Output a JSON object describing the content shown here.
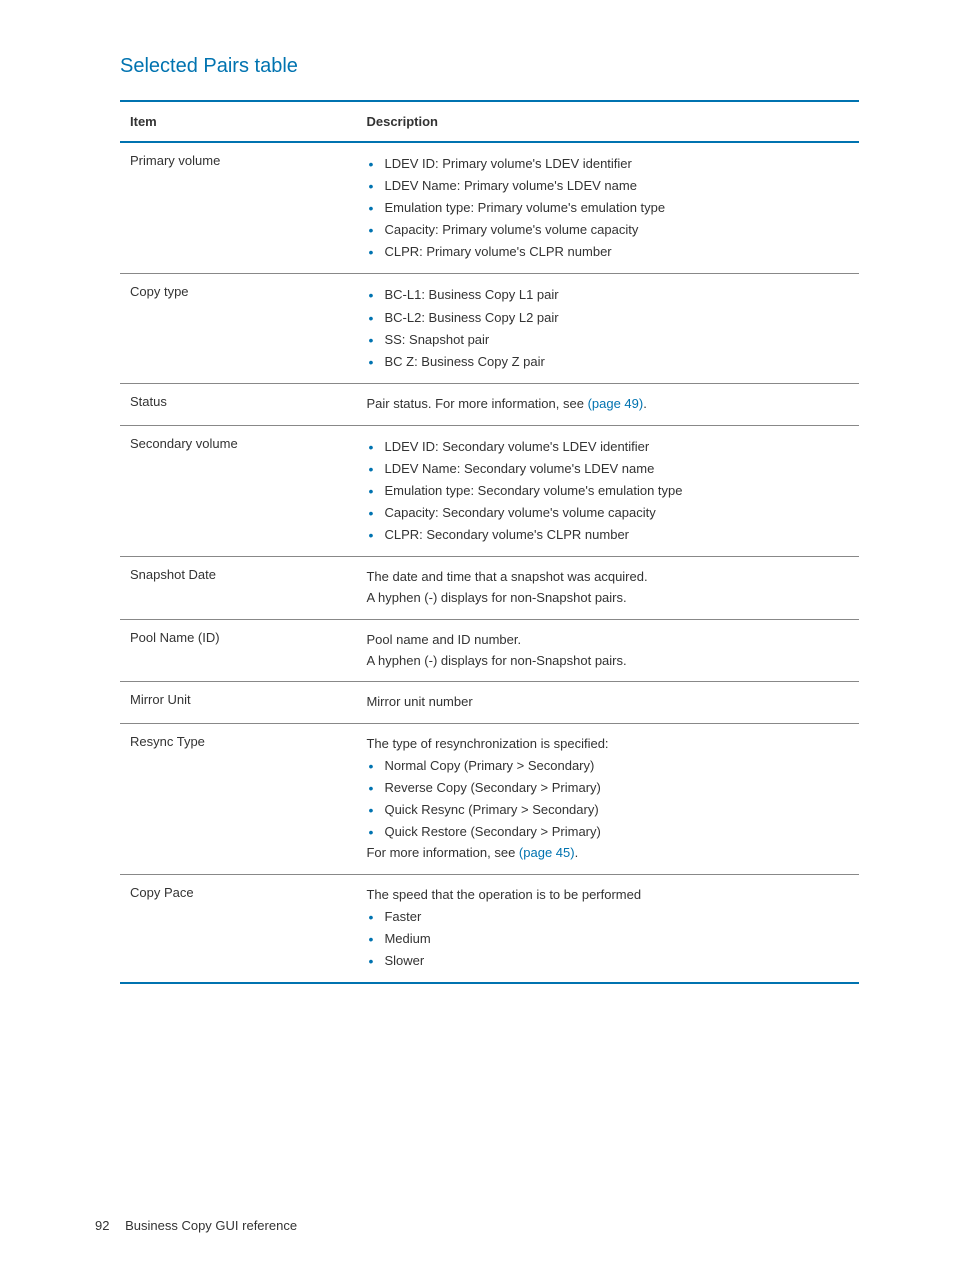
{
  "section_title": "Selected Pairs table",
  "table": {
    "header": {
      "item": "Item",
      "description": "Description"
    },
    "rows": [
      {
        "item": "Primary volume",
        "bullets": [
          "LDEV ID: Primary volume's LDEV identifier",
          "LDEV Name: Primary volume's LDEV name",
          "Emulation type: Primary volume's emulation type",
          "Capacity: Primary volume's volume capacity",
          "CLPR: Primary volume's CLPR number"
        ]
      },
      {
        "item": "Copy type",
        "bullets": [
          "BC-L1: Business Copy L1 pair",
          "BC-L2: Business Copy L2 pair",
          "SS: Snapshot pair",
          "BC Z: Business Copy Z pair"
        ]
      },
      {
        "item": "Status",
        "text_pre": "Pair status. For more information, see ",
        "link": "(page 49)",
        "text_post": "."
      },
      {
        "item": "Secondary volume",
        "bullets": [
          "LDEV ID: Secondary volume's LDEV identifier",
          "LDEV Name: Secondary volume's LDEV name",
          "Emulation type: Secondary volume's emulation type",
          "Capacity: Secondary volume's volume capacity",
          "CLPR: Secondary volume's CLPR number"
        ]
      },
      {
        "item": "Snapshot Date",
        "lines": [
          "The date and time that a snapshot was acquired.",
          "A hyphen (-) displays for non-Snapshot pairs."
        ]
      },
      {
        "item": "Pool Name (ID)",
        "lines": [
          "Pool name and ID number.",
          "A hyphen (-) displays for non-Snapshot pairs."
        ]
      },
      {
        "item": "Mirror Unit",
        "lines": [
          "Mirror unit number"
        ]
      },
      {
        "item": "Resync Type",
        "intro": "The type of resynchronization is specified:",
        "bullets": [
          "Normal Copy (Primary > Secondary)",
          "Reverse Copy (Secondary > Primary)",
          "Quick Resync (Primary > Secondary)",
          "Quick Restore (Secondary > Primary)"
        ],
        "outro_pre": "For more information, see ",
        "outro_link": "(page 45)",
        "outro_post": "."
      },
      {
        "item": "Copy Pace",
        "intro": "The speed that the operation is to be performed",
        "bullets": [
          "Faster",
          "Medium",
          "Slower"
        ]
      }
    ]
  },
  "footer": {
    "page": "92",
    "title": "Business Copy GUI reference"
  }
}
